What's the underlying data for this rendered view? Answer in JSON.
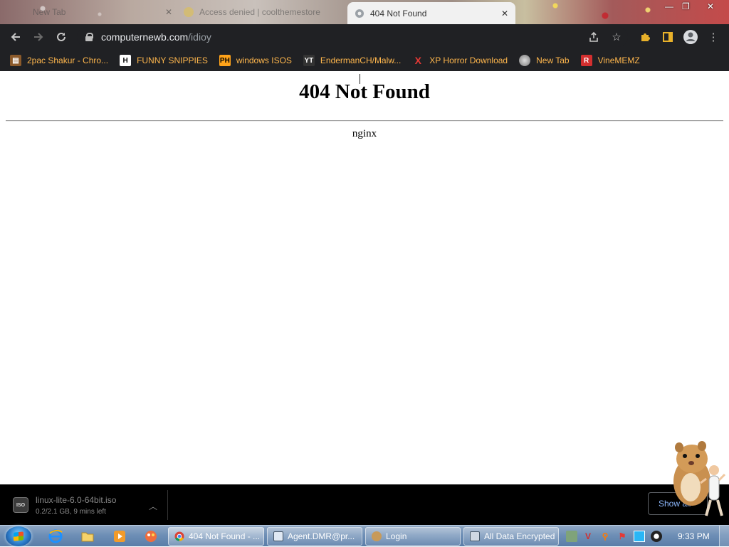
{
  "browser": {
    "tabs": [
      {
        "label": "New Tab",
        "active": false
      },
      {
        "label": "Access denied | coolthemestore",
        "active": false
      },
      {
        "label": "404 Not Found",
        "active": true
      }
    ],
    "url": {
      "host": "computernewb.com",
      "path": "/idioy"
    },
    "bookmarks": [
      {
        "label": "2pac Shakur - Chro...",
        "icon": "bookmark-icon"
      },
      {
        "label": "FUNNY SNIPPIES",
        "icon": "h-icon"
      },
      {
        "label": "windows ISOS",
        "icon": "ph-icon"
      },
      {
        "label": "EndermanCH/Malw...",
        "icon": "youtube-icon"
      },
      {
        "label": "XP Horror Download",
        "icon": "x-icon"
      },
      {
        "label": "New Tab",
        "icon": "globe-icon"
      },
      {
        "label": "VineMEMZ",
        "icon": "r-icon"
      }
    ]
  },
  "page": {
    "heading": "404 Not Found",
    "server": "nginx"
  },
  "downloads": {
    "file_name": "linux-lite-6.0-64bit.iso",
    "status": "0.2/2.1 GB, 9 mins left",
    "show_all_label": "Show all",
    "file_icon_text": "ISO"
  },
  "taskbar": {
    "tasks": [
      {
        "label": "404 Not Found - ..."
      },
      {
        "label": "Agent.DMR@pr..."
      },
      {
        "label": "Login"
      },
      {
        "label": "All Data Encrypted"
      }
    ],
    "clock": "9:33 PM"
  },
  "colors": {
    "chrome_dark": "#202124",
    "bookmark_text": "#ffb74d",
    "link_blue": "#8ab4f8"
  }
}
